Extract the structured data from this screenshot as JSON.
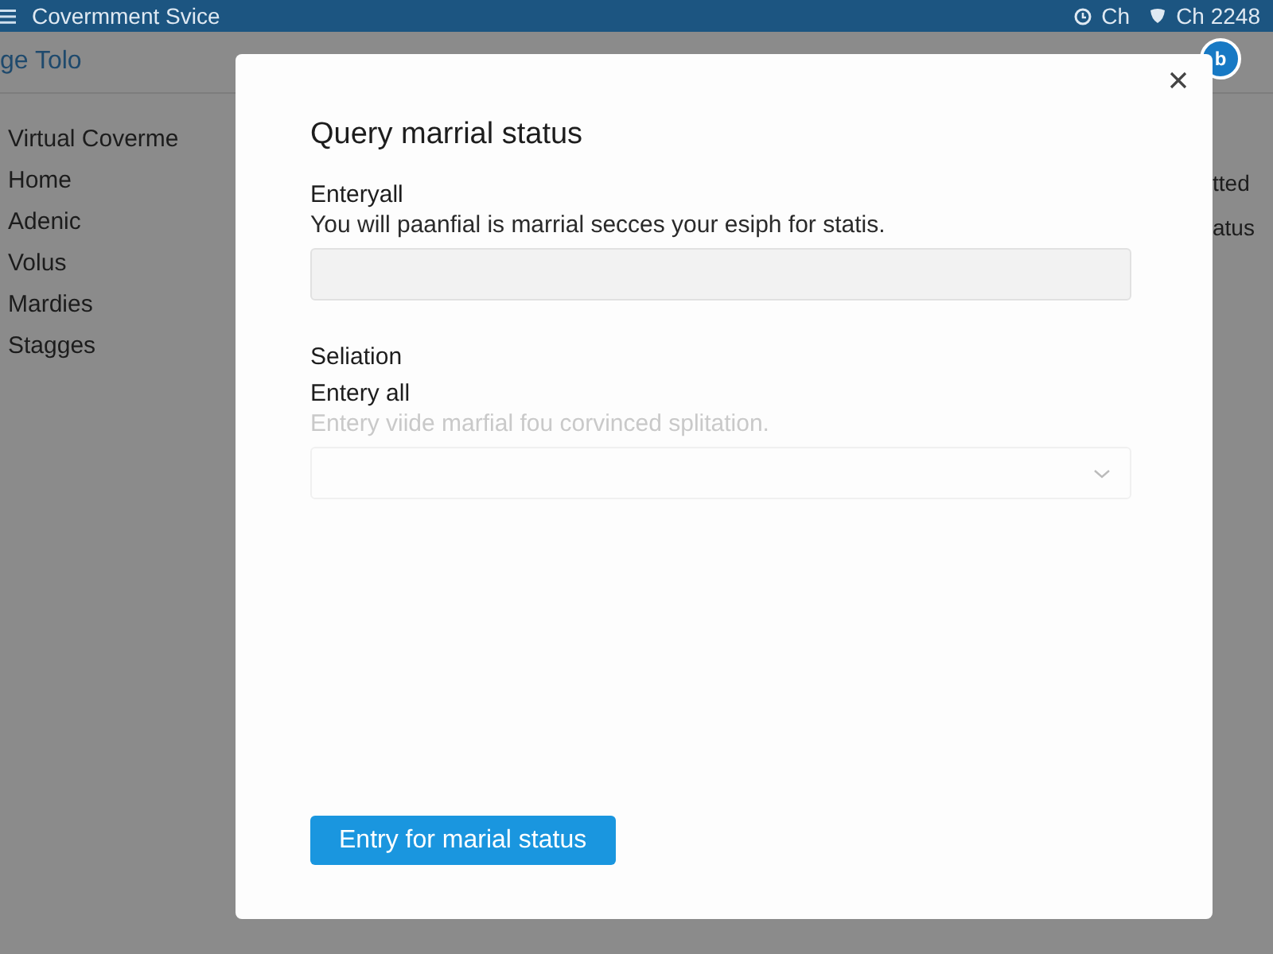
{
  "top_bar": {
    "title": "Covermment Svice",
    "status": [
      "Ch",
      "Ch 2248"
    ]
  },
  "page": {
    "title": "ge Tolo",
    "badge": "b"
  },
  "sidebar": {
    "heading": "Virtual Coverme",
    "items": [
      "Home",
      "Adenic",
      "Volus",
      "Mardies",
      "Stagges"
    ]
  },
  "right_column": [
    "tted",
    "atus"
  ],
  "dialog": {
    "title": "Query marrial status",
    "fields": [
      {
        "kind": "text",
        "label": "Enteryall",
        "description": "You will paanfial is marrial secces your esiph for statis."
      },
      {
        "kind": "select",
        "heading": "Seliation",
        "label": "Entery all",
        "description": "Entery viide marfial fou corvinced splitation."
      }
    ],
    "submit_button": "Entry for marial status"
  }
}
